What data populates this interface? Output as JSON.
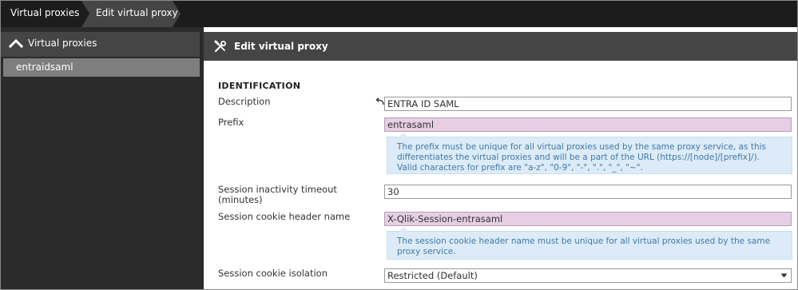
{
  "breadcrumb": {
    "items": [
      {
        "label": "Virtual proxies"
      },
      {
        "label": "Edit virtual proxy"
      }
    ]
  },
  "sidebar": {
    "header_label": "Virtual proxies",
    "header_icon": "chevron-up-icon",
    "items": [
      {
        "label": "entraidsaml"
      }
    ]
  },
  "panel": {
    "title": "Edit virtual proxy",
    "title_icon": "tools-icon"
  },
  "identification": {
    "section_title": "IDENTIFICATION",
    "description": {
      "label": "Description",
      "value": "ENTRA ID SAML",
      "revert_icon": "undo-arrow-icon"
    },
    "prefix": {
      "label": "Prefix",
      "value": "entrasaml",
      "help_lines": [
        "The prefix must be unique for all virtual proxies used by the same proxy service, as this",
        "differentiates the virtual proxies and will be a part of the URL (https://[node]/[prefix]/).",
        "Valid characters for prefix are \"a-z\", \"0-9\", \"-\", \".\", \"_\", \"~\"."
      ]
    },
    "session_timeout": {
      "label_line1": "Session inactivity timeout",
      "label_line2": "(minutes)",
      "value": "30"
    },
    "cookie_header": {
      "label": "Session cookie header name",
      "value": "X-Qlik-Session-entrasaml",
      "help_lines": [
        "The session cookie header name must be unique for all virtual proxies used by the same",
        "proxy service."
      ]
    },
    "cookie_isolation": {
      "label": "Session cookie isolation",
      "selected": "Restricted (Default)"
    }
  },
  "colors": {
    "topbar": "#1c1c1c",
    "active_crumb": "#454545",
    "sidebar_bg": "#2b2b2b",
    "sidebar_selected": "#7e7e7e",
    "error_field": "#e6cfe2",
    "help_bg": "#dcebf7",
    "help_text": "#3f79a9"
  }
}
